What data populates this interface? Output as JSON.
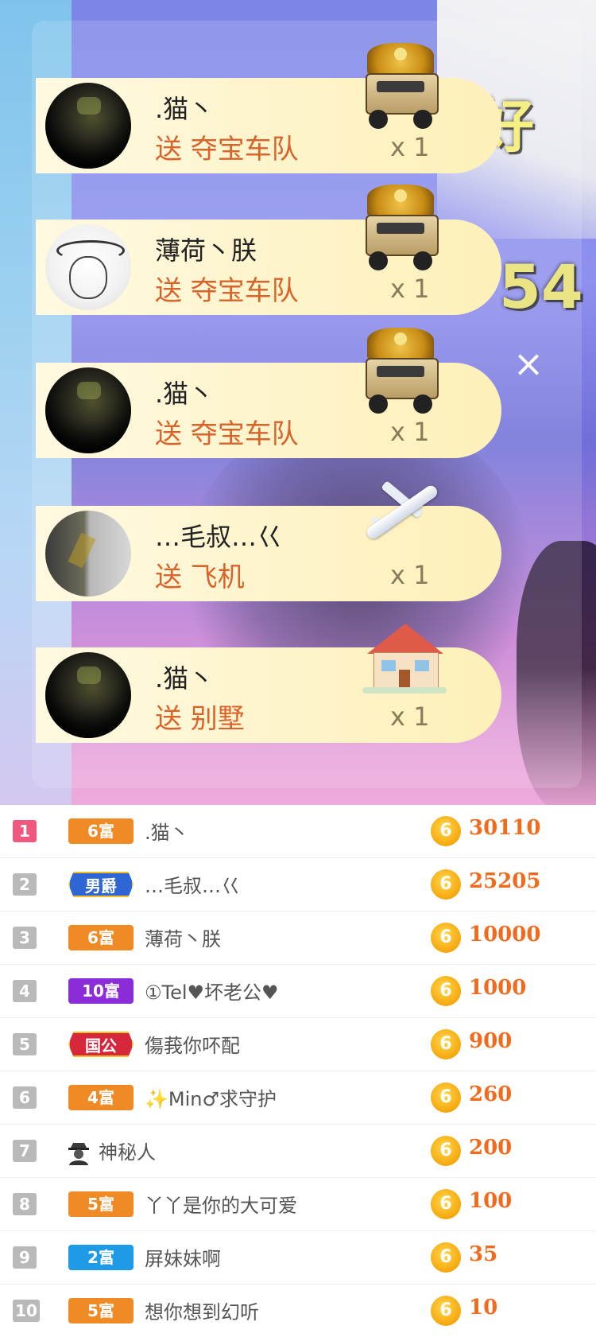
{
  "gift_feed": [
    {
      "user": ".猫丶",
      "action": "送 夺宝车队",
      "count": "x 1",
      "gift": "truck-gift-icon",
      "avatar": "dark"
    },
    {
      "user": "薄荷丶朕",
      "action": "送 夺宝车队",
      "count": "x 1",
      "gift": "truck-gift-icon",
      "avatar": "sketch"
    },
    {
      "user": ".猫丶",
      "action": "送 夺宝车队",
      "count": "x 1",
      "gift": "truck-gift-icon",
      "avatar": "dark"
    },
    {
      "user": "…毛叔…巜",
      "action": "送 飞机",
      "count": "x 1",
      "gift": "plane-gift-icon",
      "avatar": "gray"
    },
    {
      "user": ".猫丶",
      "action": "送 别墅",
      "count": "x 1",
      "gift": "villa-gift-icon",
      "avatar": "dark"
    }
  ],
  "close_label": "×",
  "background_text": {
    "a": "好",
    "b": "54"
  },
  "coin_glyph": "6",
  "ranking": [
    {
      "rank": "1",
      "badge": "6富",
      "badge_color": "#f08a24",
      "name": ".猫丶",
      "value": "30110"
    },
    {
      "rank": "2",
      "badge": "男爵",
      "badge_color": "#2f66d6",
      "name": "…毛叔…巜",
      "value": "25205"
    },
    {
      "rank": "3",
      "badge": "6富",
      "badge_color": "#f08a24",
      "name": "薄荷丶朕",
      "value": "10000"
    },
    {
      "rank": "4",
      "badge": "10富",
      "badge_color": "#8c2bd8",
      "name": "①Tel♥坏老公♥",
      "value": "1000"
    },
    {
      "rank": "5",
      "badge": "国公",
      "badge_color": "#d6283a",
      "name": "傷莪你吥配",
      "value": "900"
    },
    {
      "rank": "6",
      "badge": "4富",
      "badge_color": "#f08a24",
      "name": "✨Min♂求守护",
      "value": "260"
    },
    {
      "rank": "7",
      "badge": "",
      "badge_color": "",
      "name": "神秘人",
      "value": "200"
    },
    {
      "rank": "8",
      "badge": "5富",
      "badge_color": "#f08a24",
      "name": "丫丫是你的大可爱",
      "value": "100"
    },
    {
      "rank": "9",
      "badge": "2富",
      "badge_color": "#1f9ae6",
      "name": "屏妹妹啊",
      "value": "35"
    },
    {
      "rank": "10",
      "badge": "5富",
      "badge_color": "#f08a24",
      "name": "想你想到幻听",
      "value": "10"
    }
  ]
}
